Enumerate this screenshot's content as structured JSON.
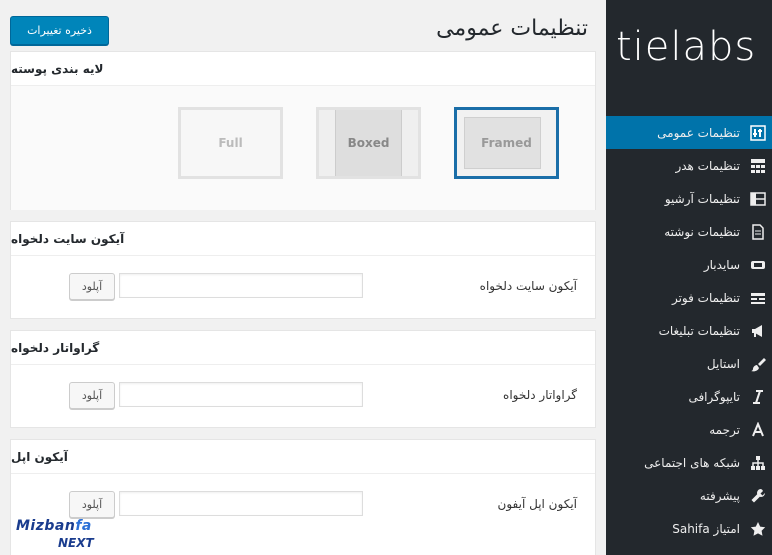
{
  "app": {
    "logo_text": "tielabs",
    "title": "تنظیمات عمومی",
    "save_label": "ذخیره تغییرات"
  },
  "sidebar": {
    "items": [
      {
        "label": "تنظیمات عمومی",
        "icon": "settings-icon",
        "active": true
      },
      {
        "label": "تنظیمات هدر",
        "icon": "header-icon",
        "active": false
      },
      {
        "label": "تنظیمات آرشیو",
        "icon": "archive-icon",
        "active": false
      },
      {
        "label": "تنظیمات نوشته",
        "icon": "post-icon",
        "active": false
      },
      {
        "label": "سایدبار",
        "icon": "sidebar-icon",
        "active": false
      },
      {
        "label": "تنظیمات فوتر",
        "icon": "footer-icon",
        "active": false
      },
      {
        "label": "تنظیمات تبلیغات",
        "icon": "megaphone-icon",
        "active": false
      },
      {
        "label": "استایل",
        "icon": "brush-icon",
        "active": false
      },
      {
        "label": "تایپوگرافی",
        "icon": "italic-icon",
        "active": false
      },
      {
        "label": "ترجمه",
        "icon": "translate-icon",
        "active": false
      },
      {
        "label": "شبکه های اجتماعی",
        "icon": "sitemap-icon",
        "active": false
      },
      {
        "label": "پیشرفته",
        "icon": "wrench-icon",
        "active": false
      },
      {
        "label": "امتیاز Sahifa",
        "icon": "star-icon",
        "active": false
      }
    ]
  },
  "layout_section": {
    "heading": "لایه بندی پوسته",
    "options": [
      {
        "label": "Full",
        "selected": false
      },
      {
        "label": "Boxed",
        "selected": false
      },
      {
        "label": "Framed",
        "selected": true
      }
    ]
  },
  "favicon_section": {
    "heading": "آیکون سایت دلخواه",
    "field_label": "آیکون سایت دلخواه",
    "input_value": "",
    "upload_label": "آپلود"
  },
  "gravatar_section": {
    "heading": "گراواتار دلخواه",
    "field_label": "گراواتار دلخواه",
    "input_value": "",
    "upload_label": "آپلود"
  },
  "apple_section": {
    "heading": "آیکون اپل",
    "field_label": "آیکون اپل آیفون",
    "input_value": "",
    "upload_label": "آپلود"
  },
  "watermark": {
    "brand_a": "Mizban",
    "brand_b": "fa",
    "sub": "NEXT"
  },
  "colors": {
    "sidebar_bg": "#23282d",
    "accent": "#0073aa",
    "button": "#0085ba",
    "framed_border": "#1a6ea8"
  }
}
